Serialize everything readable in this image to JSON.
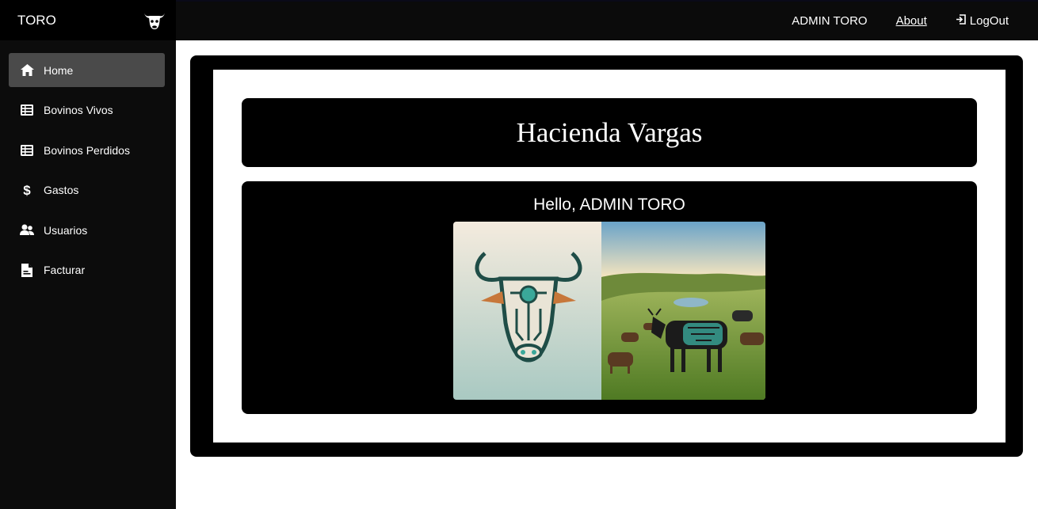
{
  "brand": {
    "title": "TORO",
    "icon": "bull-head-icon"
  },
  "topbar": {
    "user_label": "ADMIN TORO",
    "about_label": "About",
    "logout_label": "LogOut",
    "logout_icon": "logout-icon"
  },
  "sidebar": {
    "items": [
      {
        "label": "Home",
        "icon": "home-icon",
        "active": true
      },
      {
        "label": "Bovinos Vivos",
        "icon": "table-list-icon",
        "active": false
      },
      {
        "label": "Bovinos Perdidos",
        "icon": "table-list-icon",
        "active": false
      },
      {
        "label": "Gastos",
        "icon": "dollar-icon",
        "active": false
      },
      {
        "label": "Usuarios",
        "icon": "users-icon",
        "active": false
      },
      {
        "label": "Facturar",
        "icon": "invoice-icon",
        "active": false
      }
    ]
  },
  "main": {
    "title": "Hacienda Vargas",
    "greeting": "Hello, ADMIN TORO",
    "image_icon": "bull-circuit-logo-and-cattle-pasture-image"
  },
  "colors": {
    "sidebar_bg": "#0c0c0c",
    "active_item_bg": "#4a4a4a",
    "card_bg": "#000000",
    "text": "#ffffff",
    "teal_accent": "#3aa89a"
  }
}
